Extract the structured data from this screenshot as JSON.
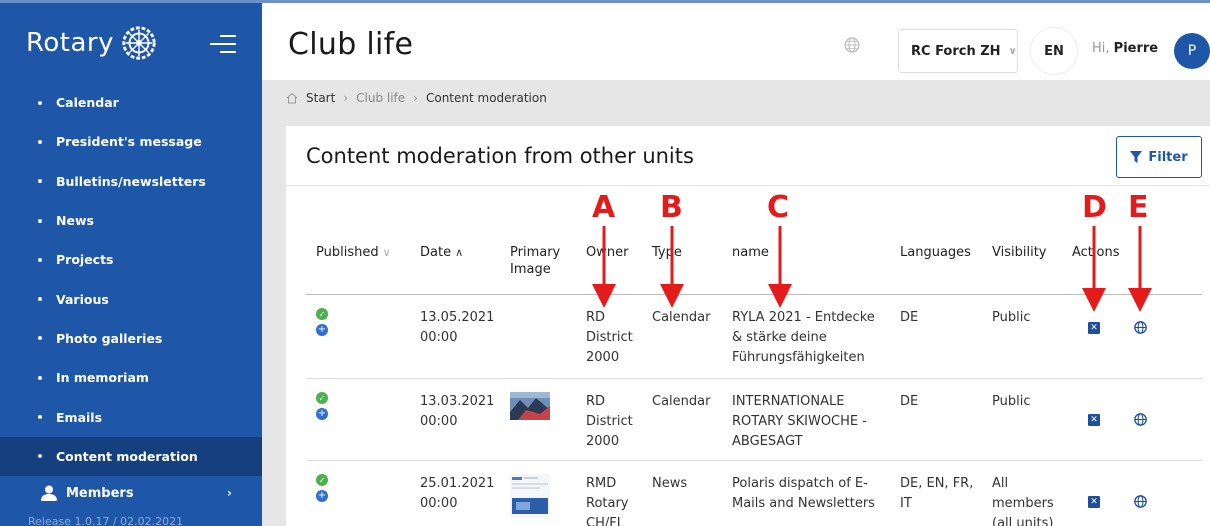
{
  "sidebar": {
    "brand": "Rotary",
    "items": [
      {
        "label": "Calendar"
      },
      {
        "label": "President's message"
      },
      {
        "label": "Bulletins/newsletters"
      },
      {
        "label": "News"
      },
      {
        "label": "Projects"
      },
      {
        "label": "Various"
      },
      {
        "label": "Photo galleries"
      },
      {
        "label": "In memoriam"
      },
      {
        "label": "Emails"
      },
      {
        "label": "Content moderation"
      }
    ],
    "active_item": "Content moderation",
    "members_label": "Members",
    "release": "Release 1.0.17 / 02.02.2021"
  },
  "header": {
    "title": "Club life",
    "club": "RC Forch ZH",
    "language": "EN",
    "greeting_prefix": "Hi,",
    "user_name": "Pierre",
    "avatar_initial": "P"
  },
  "breadcrumb": [
    "Start",
    "Club life",
    "Content moderation"
  ],
  "card": {
    "title": "Content moderation from other units",
    "filter_label": "Filter"
  },
  "table": {
    "columns": {
      "published": "Published",
      "date": "Date",
      "primary_image_1": "Primary",
      "primary_image_2": "Image",
      "owner": "Owner",
      "type": "Type",
      "name": "name",
      "languages": "Languages",
      "visibility": "Visibility",
      "actions": "Actions"
    },
    "rows": [
      {
        "date": "13.05.2021",
        "time": "00:00",
        "owner": [
          "RD",
          "District",
          "2000"
        ],
        "type": "Calendar",
        "name": [
          "RYLA 2021 - Entdecke",
          "& stärke deine",
          "Führungsfähigkeiten"
        ],
        "languages": [
          "DE"
        ],
        "visibility": [
          "Public"
        ],
        "has_image": false
      },
      {
        "date": "13.03.2021",
        "time": "00:00",
        "owner": [
          "RD",
          "District",
          "2000"
        ],
        "type": "Calendar",
        "name": [
          "INTERNATIONALE",
          "ROTARY SKIWOCHE -",
          "ABGESAGT"
        ],
        "languages": [
          "DE"
        ],
        "visibility": [
          "Public"
        ],
        "has_image": true
      },
      {
        "date": "25.01.2021",
        "time": "00:00",
        "owner": [
          "RMD",
          "Rotary",
          "CH/FL"
        ],
        "type": "News",
        "name": [
          "Polaris dispatch of E-",
          "Mails and Newsletters"
        ],
        "languages": [
          "DE, EN, FR,",
          "IT"
        ],
        "visibility": [
          "All",
          "members",
          "(all units)"
        ],
        "has_image": true
      }
    ]
  },
  "annotations": [
    "A",
    "B",
    "C",
    "D",
    "E"
  ],
  "colors": {
    "sidebar": "#1f57a8",
    "sidebar_active": "#14407f",
    "annotation": "#e31b1b",
    "published_ok": "#4caf50"
  }
}
